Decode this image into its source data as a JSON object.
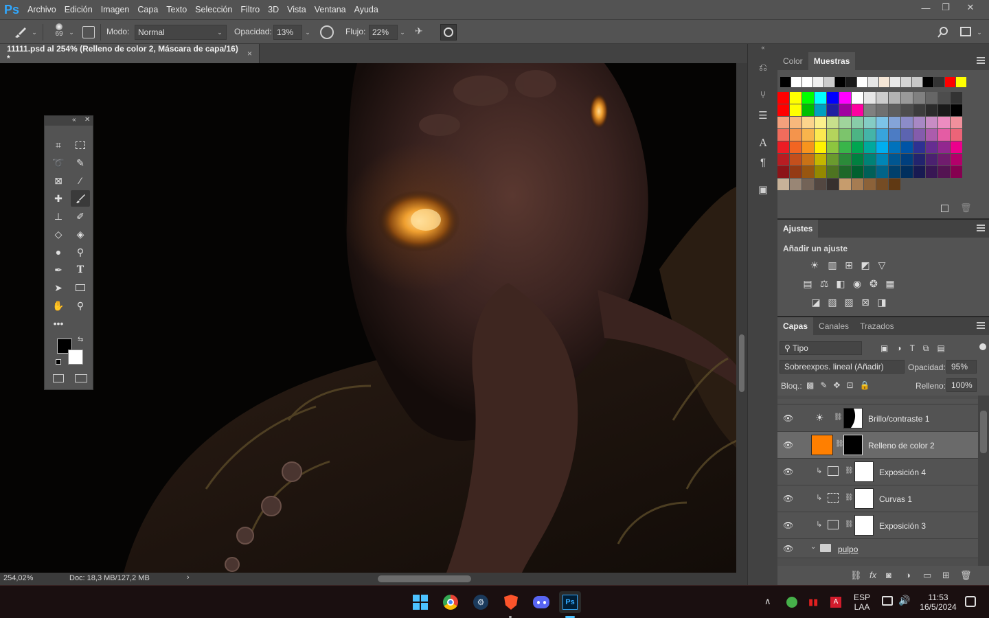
{
  "app": {
    "logo": "Ps"
  },
  "menu": [
    "Archivo",
    "Edición",
    "Imagen",
    "Capa",
    "Texto",
    "Selección",
    "Filtro",
    "3D",
    "Vista",
    "Ventana",
    "Ayuda"
  ],
  "window_controls": {
    "minimize": "—",
    "restore": "❐",
    "close": "✕"
  },
  "options": {
    "brush_size": "69",
    "mode_label": "Modo:",
    "mode_value": "Normal",
    "opacity_label": "Opacidad:",
    "opacity_value": "13%",
    "flow_label": "Flujo:",
    "flow_value": "22%"
  },
  "document": {
    "tab_title": "11111.psd al 254% (Relleno de color 2, Máscara de capa/16) *",
    "close": "×"
  },
  "status": {
    "zoom": "254,02%",
    "doc": "Doc: 18,3 MB/127,2 MB",
    "arrow": "›"
  },
  "swatches_panel": {
    "tabs": [
      "Color",
      "Muestras"
    ],
    "active": "Muestras",
    "recent": [
      "#000000",
      "#ffffff",
      "#ffffff",
      "#f0f0f0",
      "#cccccc",
      "#000000",
      "#1a1a1a",
      "#ffffff",
      "#e6e6e6",
      "#f5e6d6",
      "#e8e8e8",
      "#d4d4d4",
      "#c8c8c8",
      "#000000",
      "#333333",
      "#ff0000",
      "#ffff00"
    ],
    "rows": [
      [
        "#ff0000",
        "#ffff00",
        "#00ff00",
        "#00ffff",
        "#0000ff",
        "#ff00ff",
        "#ffffff",
        "#e6e6e6",
        "#cccccc",
        "#b3b3b3",
        "#999999",
        "#808080",
        "#666666",
        "#4d4d4d",
        "#333333"
      ],
      [
        "#ff0000",
        "#ffff00",
        "#00c000",
        "#00a0c0",
        "#2020a0",
        "#a000a0",
        "#ff00a0",
        "#808080",
        "#707070",
        "#5e5e5e",
        "#4d4d4d",
        "#3c3c3c",
        "#2b2b2b",
        "#1a1a1a",
        "#000000"
      ],
      [
        "#f4a07c",
        "#f8b87c",
        "#fcd48c",
        "#fcf08c",
        "#c8e08c",
        "#a0d49c",
        "#88cca8",
        "#84ccc4",
        "#7cc4e8",
        "#84a4d8",
        "#8c8cc8",
        "#a888c4",
        "#c88cc4",
        "#ec8cc0",
        "#f0909c"
      ],
      [
        "#f06c5c",
        "#f4944c",
        "#f8b44c",
        "#fce850",
        "#b4d45c",
        "#7cc46c",
        "#4cb484",
        "#44b4a8",
        "#38a4dc",
        "#4c7cc4",
        "#5c64b0",
        "#845cac",
        "#ac5cac",
        "#e45ca4",
        "#ec6478"
      ],
      [
        "#ec1c24",
        "#f26522",
        "#f7941d",
        "#fff200",
        "#8dc63f",
        "#39b54a",
        "#00a651",
        "#00a99d",
        "#00aeef",
        "#0072bc",
        "#0054a6",
        "#2e3192",
        "#662d91",
        "#92278f",
        "#ec008c"
      ],
      [
        "#b81d22",
        "#c44f1c",
        "#c97216",
        "#c4b600",
        "#6a9a2e",
        "#2b8a39",
        "#008040",
        "#008276",
        "#0086b6",
        "#005691",
        "#003f7e",
        "#22246e",
        "#4b2170",
        "#701c6d",
        "#b3006a"
      ],
      [
        "#8c1418",
        "#943a14",
        "#985610",
        "#938800",
        "#4e7421",
        "#1f6829",
        "#00602f",
        "#006058",
        "#006488",
        "#00406c",
        "#002f5e",
        "#181a52",
        "#381754",
        "#541452",
        "#860050"
      ],
      [
        "#c7b299",
        "#998675",
        "#736357",
        "#534741",
        "#37302e",
        "#c69c6d",
        "#a67c52",
        "#8c6239",
        "#754c24",
        "#603913"
      ]
    ]
  },
  "adjustments_panel": {
    "title": "Ajustes",
    "subtitle": "Añadir un ajuste"
  },
  "layers_panel": {
    "tabs": [
      "Capas",
      "Canales",
      "Trazados"
    ],
    "active": "Capas",
    "filter": "Tipo",
    "blend_mode": "Sobreexpos. lineal (Añadir)",
    "opacity_label": "Opacidad:",
    "opacity_value": "95%",
    "lock_label": "Bloq.:",
    "fill_label": "Relleno:",
    "fill_value": "100%",
    "layers": [
      {
        "name": "Brillo/contraste 1",
        "icon": "brightness-icon"
      },
      {
        "name": "Relleno de color 2",
        "icon": "solid-fill",
        "color": "#ff7f00"
      },
      {
        "name": "Exposición 4",
        "icon": "exposure-icon"
      },
      {
        "name": "Curvas 1",
        "icon": "curves-icon"
      },
      {
        "name": "Exposición 3",
        "icon": "exposure-icon"
      },
      {
        "name": "pulpo",
        "icon": "folder-icon"
      }
    ]
  },
  "taskbar": {
    "lang_top": "ESP",
    "lang_bottom": "LAA",
    "time": "11:53",
    "date": "16/5/2024",
    "ps_label": "Ps"
  }
}
